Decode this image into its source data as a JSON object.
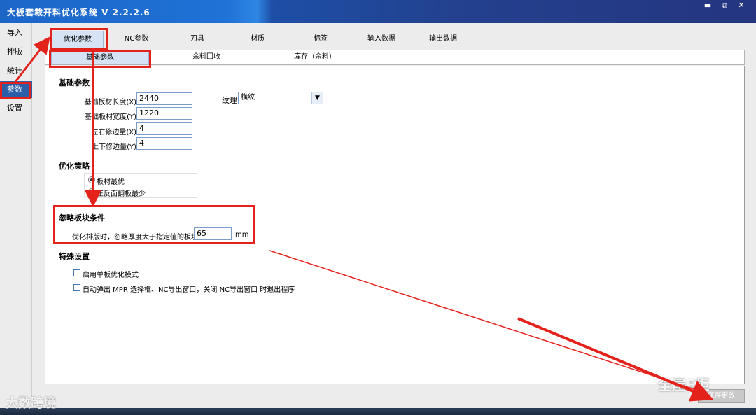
{
  "window": {
    "title": "大板套裁开料优化系统 V 2.2.2.6",
    "controls": [
      "▬",
      "⧉",
      "✕"
    ]
  },
  "sidebar": {
    "items": [
      {
        "label": "导入",
        "active": false
      },
      {
        "label": "排版",
        "active": false
      },
      {
        "label": "统计",
        "active": false
      },
      {
        "label": "参数",
        "active": true
      },
      {
        "label": "设置",
        "active": false
      }
    ]
  },
  "tabs": {
    "main": [
      {
        "label": "优化参数",
        "active": true
      },
      {
        "label": "NC参数",
        "active": false
      },
      {
        "label": "刀具",
        "active": false
      },
      {
        "label": "材质",
        "active": false
      },
      {
        "label": "标签",
        "active": false
      },
      {
        "label": "输入数据",
        "active": false
      },
      {
        "label": "输出数据",
        "active": false
      }
    ],
    "sub": [
      {
        "label": "基础参数",
        "active": true
      },
      {
        "label": "余料回收",
        "active": false
      },
      {
        "label": "库存（余料）",
        "active": false
      }
    ]
  },
  "basic": {
    "heading": "基础参数",
    "fields": [
      {
        "label": "基础板材长度(X)",
        "value": "2440"
      },
      {
        "label": "基础板材宽度(Y)",
        "value": "1220"
      },
      {
        "label": "左右修边量(X)",
        "value": "4"
      },
      {
        "label": "上下修边量(Y)",
        "value": "4"
      }
    ],
    "grain_label": "纹理",
    "grain_value": "横纹"
  },
  "strategy": {
    "heading": "优化策略",
    "options": [
      {
        "label": "板材最优",
        "checked": true
      },
      {
        "label": "正反面翻板最少",
        "checked": false
      }
    ]
  },
  "ignore": {
    "heading": "忽略板块条件",
    "label": "优化排版时，忽略厚度大于指定值的板块",
    "value": "65",
    "unit": "mm"
  },
  "special": {
    "heading": "特殊设置",
    "options": [
      {
        "label": "启用单板优化模式",
        "checked": false
      },
      {
        "label": "自动弹出 MPR 选择框、NC导出窗口，关闭 NC导出窗口 时退出程序",
        "checked": false
      }
    ]
  },
  "save_button": "保存更改",
  "watermarks": {
    "left": "大数跨境",
    "right": "全屋E柜"
  },
  "annotation_color": "#e4221c"
}
